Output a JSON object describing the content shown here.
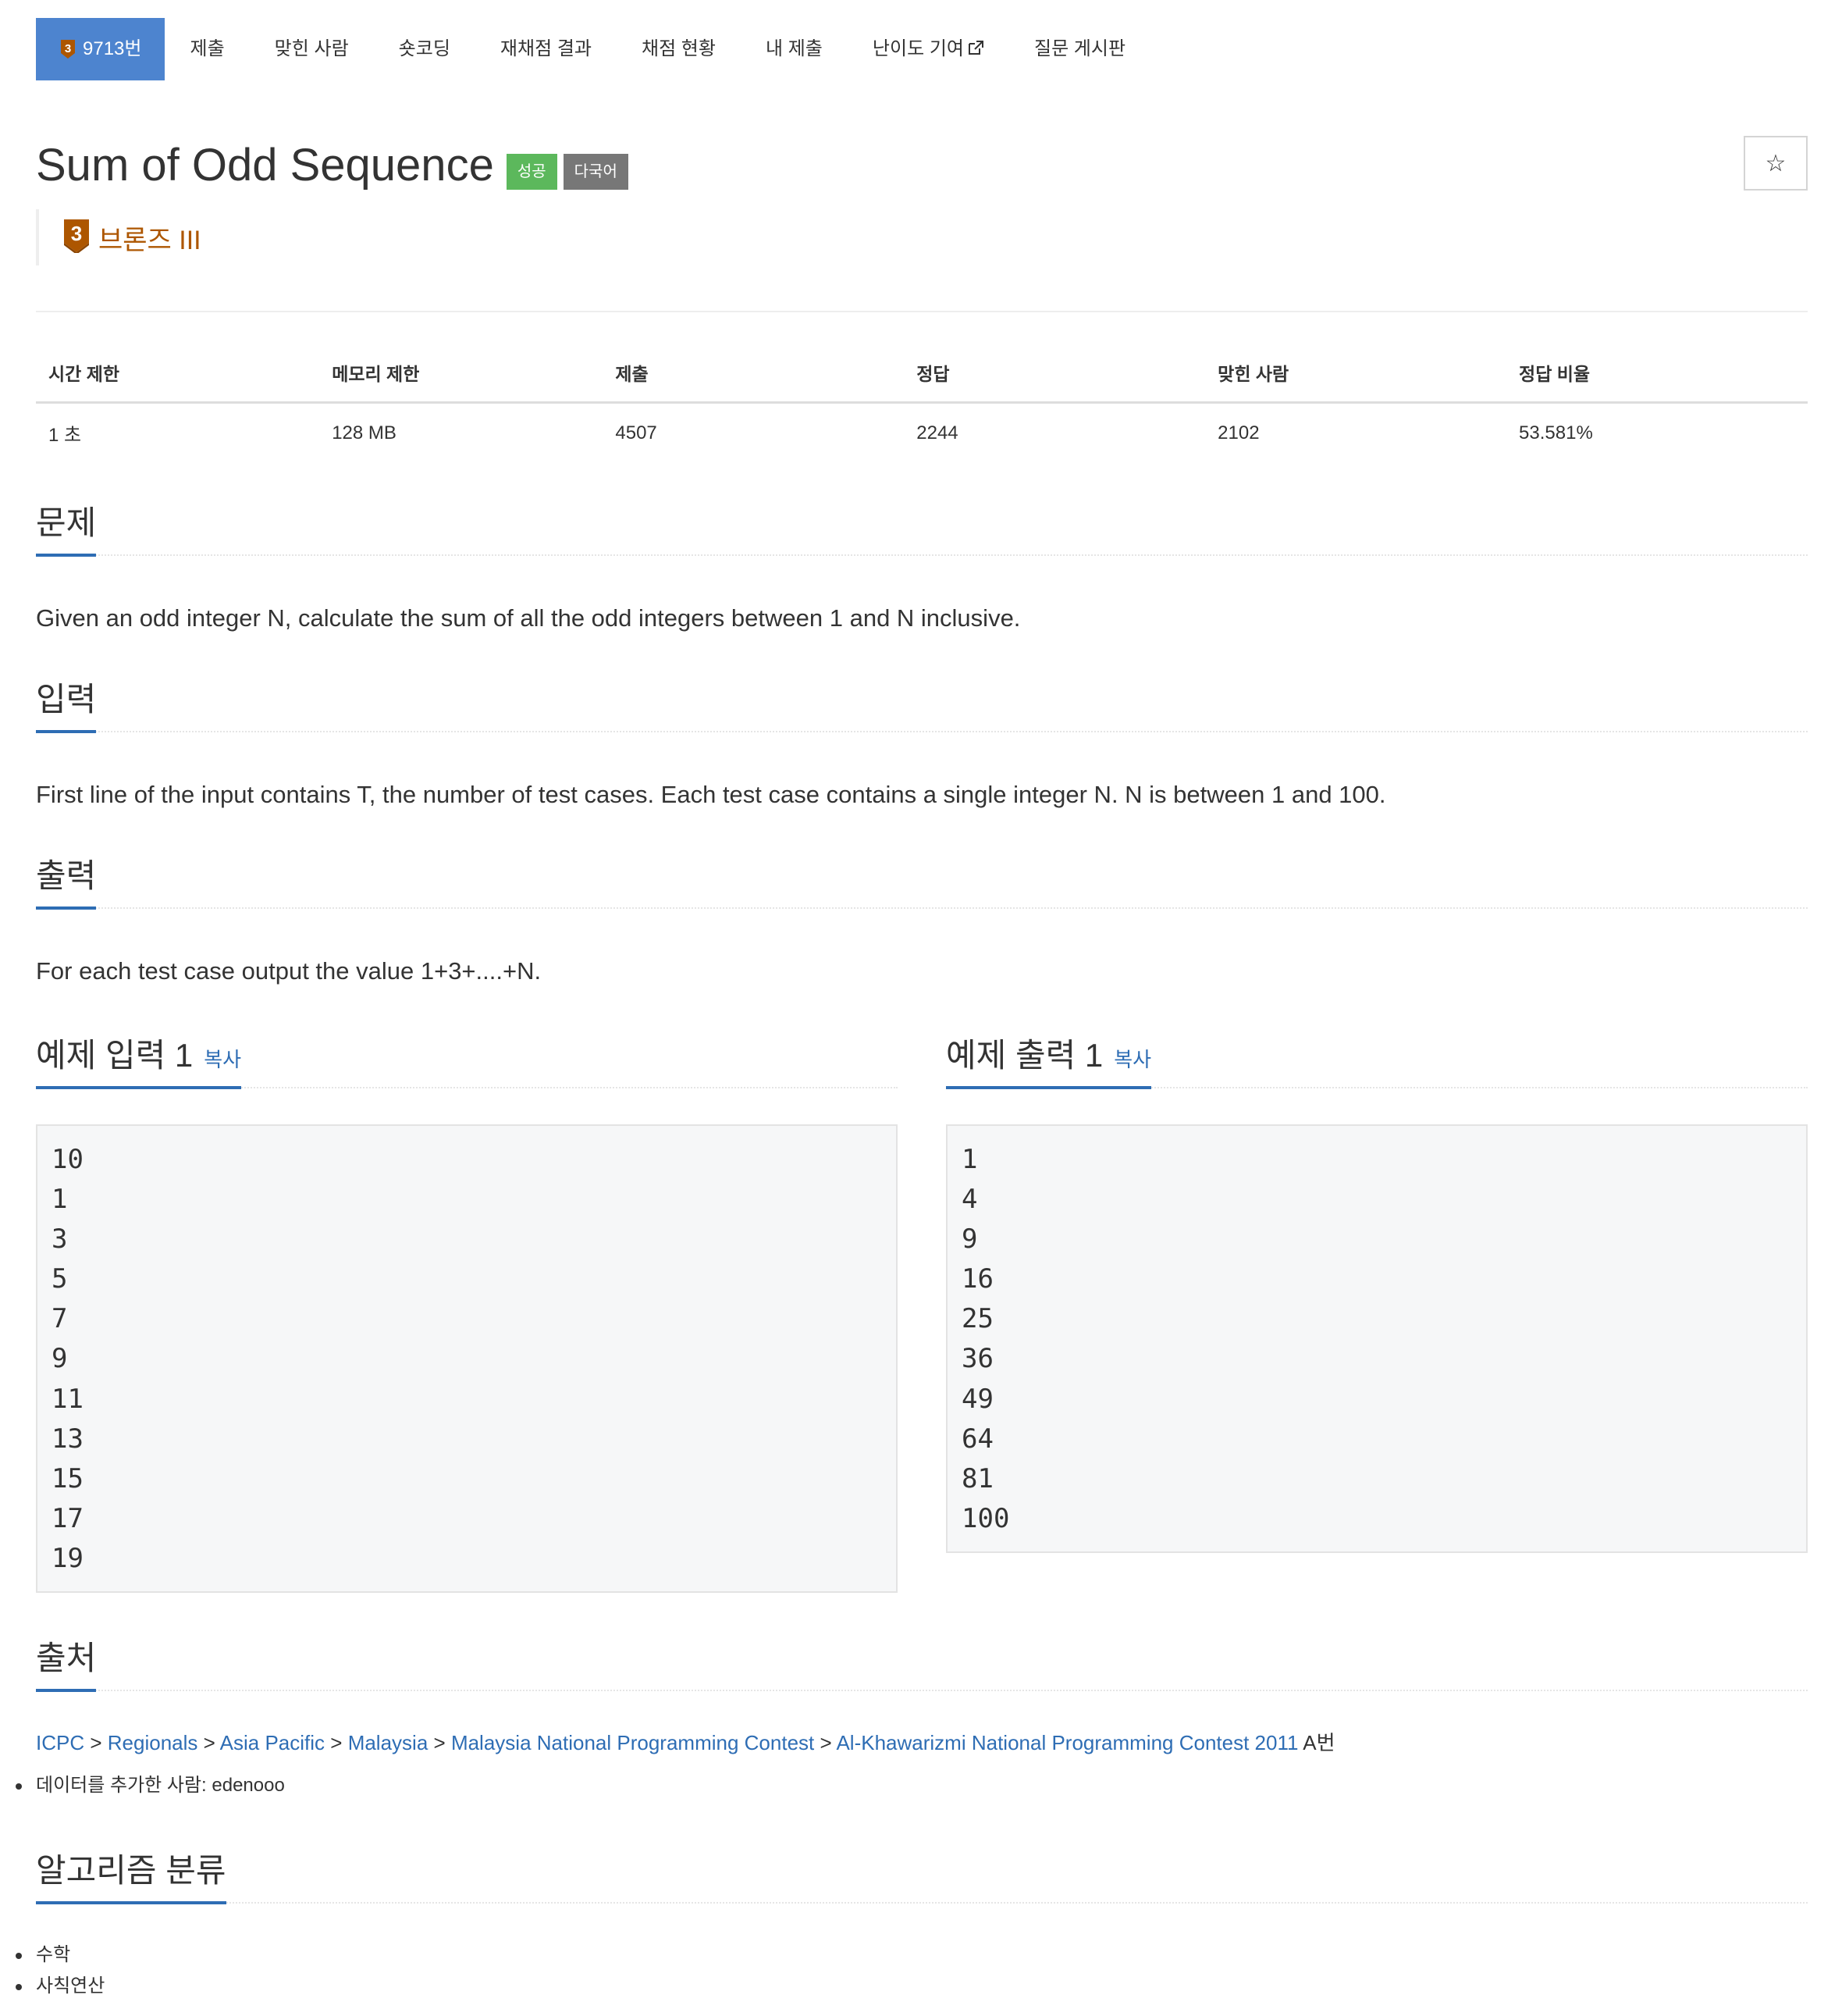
{
  "nav": {
    "problem_tab": {
      "tier_number": "3",
      "label": "9713번"
    },
    "items": [
      {
        "label": "제출"
      },
      {
        "label": "맞힌 사람"
      },
      {
        "label": "숏코딩"
      },
      {
        "label": "재채점 결과"
      },
      {
        "label": "채점 현황"
      },
      {
        "label": "내 제출"
      },
      {
        "label": "난이도 기여"
      },
      {
        "label": "질문 게시판"
      }
    ]
  },
  "problem": {
    "title": "Sum of Odd Sequence",
    "badges": {
      "success": "성공",
      "multilingual": "다국어"
    },
    "star_icon": "☆",
    "tier": {
      "number": "3",
      "name": "브론즈 III",
      "color": "#ad5600"
    }
  },
  "info_table": {
    "headers": [
      "시간 제한",
      "메모리 제한",
      "제출",
      "정답",
      "맞힌 사람",
      "정답 비율"
    ],
    "values": [
      "1 초",
      "128 MB",
      "4507",
      "2244",
      "2102",
      "53.581%"
    ]
  },
  "sections": {
    "description": {
      "title": "문제",
      "text": "Given an odd integer N, calculate the sum of all the odd integers between 1 and N inclusive."
    },
    "input": {
      "title": "입력",
      "text": "First line of the input contains T, the number of test cases. Each test case contains a single integer N. N is between 1 and 100."
    },
    "output": {
      "title": "출력",
      "text": "For each test case output the value 1+3+....+N."
    },
    "sample_input": {
      "title": "예제 입력 1",
      "copy": "복사",
      "lines": [
        "10",
        "1",
        "3",
        "5",
        "7",
        "9",
        "11",
        "13",
        "15",
        "17",
        "19"
      ]
    },
    "sample_output": {
      "title": "예제 출력 1",
      "copy": "복사",
      "lines": [
        "1",
        "4",
        "9",
        "16",
        "25",
        "36",
        "49",
        "64",
        "81",
        "100"
      ]
    },
    "source": {
      "title": "출처",
      "links": [
        "ICPC",
        "Regionals",
        "Asia Pacific",
        "Malaysia",
        "Malaysia National Programming Contest",
        "Al-Khawarizmi National Programming Contest 2011"
      ],
      "separator": ">",
      "suffix": "A번",
      "data_added_by": "데이터를 추가한 사람: edenooo"
    },
    "algorithms": {
      "title": "알고리즘 분류",
      "items": [
        "수학",
        "사칙연산"
      ]
    }
  },
  "colors": {
    "accent": "#4d84cf",
    "link": "#2e6db4",
    "success": "#5cb85c",
    "multilingual": "#777777",
    "bronze": "#ad5600"
  }
}
